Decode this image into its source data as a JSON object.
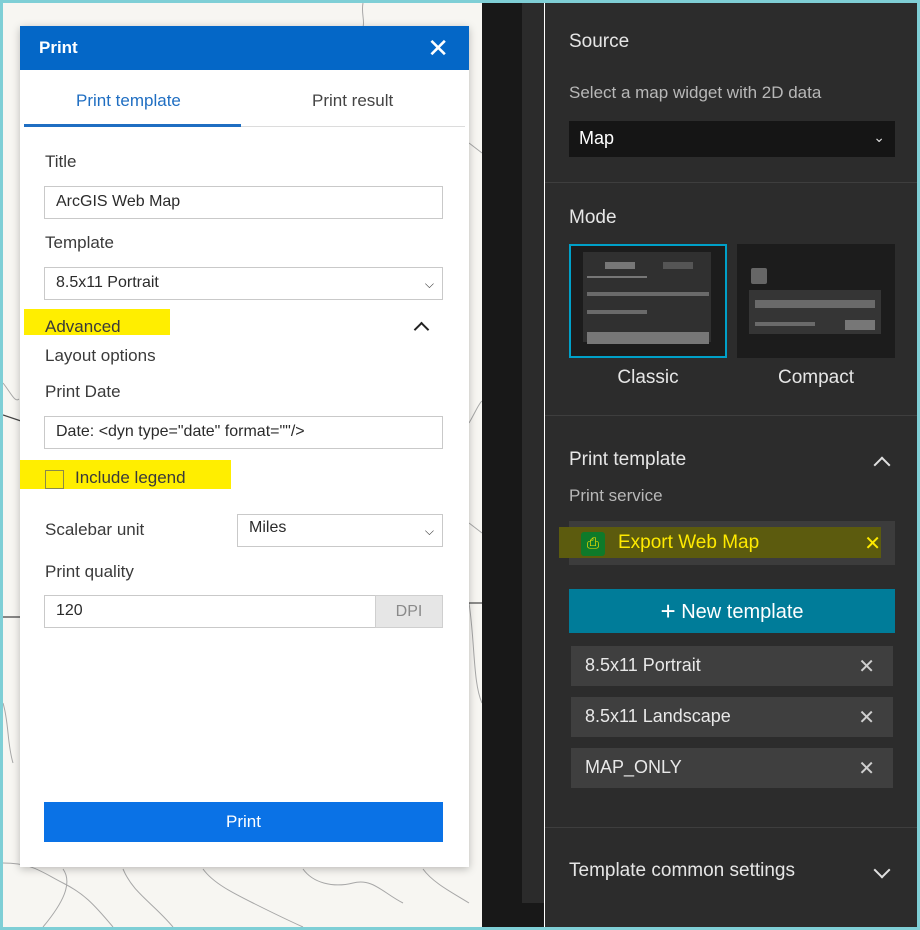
{
  "dialog": {
    "title": "Print",
    "close_icon": "close-icon",
    "tabs": [
      {
        "label": "Print template"
      },
      {
        "label": "Print result"
      }
    ],
    "title_label": "Title",
    "title_value": "ArcGIS Web Map",
    "template_label": "Template",
    "template_value": "8.5x11 Portrait",
    "advanced_label": "Advanced",
    "layout_options_label": "Layout options",
    "print_date_label": "Print Date",
    "print_date_value": "Date: <dyn type=\"date\" format=\"\"/>",
    "include_legend_label": "Include legend",
    "include_legend_checked": false,
    "scalebar_label": "Scalebar unit",
    "scalebar_value": "Miles",
    "quality_label": "Print quality",
    "quality_value": "120",
    "quality_unit": "DPI",
    "print_button": "Print",
    "accent": "#0467c7",
    "highlight": "#ffee00"
  },
  "settings": {
    "source_heading": "Source",
    "source_sub": "Select a map widget with 2D data",
    "source_value": "Map",
    "mode_heading": "Mode",
    "modes": [
      {
        "label": "Classic",
        "selected": true
      },
      {
        "label": "Compact",
        "selected": false
      }
    ],
    "print_template_heading": "Print template",
    "print_service_label": "Print service",
    "service_name": "Export Web Map",
    "service_icon": "printer-icon",
    "new_template_button": "New template",
    "templates": [
      {
        "label": "8.5x11 Portrait"
      },
      {
        "label": "8.5x11 Landscape"
      },
      {
        "label": "MAP_ONLY"
      }
    ],
    "common_settings_heading": "Template common settings",
    "accent": "#007c99"
  }
}
